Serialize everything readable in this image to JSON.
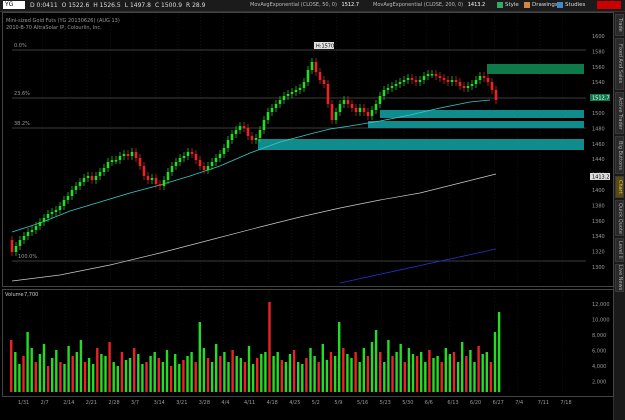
{
  "toolbar": {
    "symbol": "YG",
    "ohlc": {
      "change": "D 0:0411",
      "open": "O 1522.6",
      "high": "H 1526.5",
      "low": "L 1497.8",
      "close": "C 1500.9",
      "range": "R 28.9"
    },
    "ma50_label": "MovAvgExponential (CLOSE, 50, 0)",
    "ma50_value": "1512.7",
    "ma200_label": "MovAvgExponential (CLOSE, 200, 0)",
    "ma200_value": "1413.2",
    "style_label": "Style",
    "drawings_label": "Drawings",
    "studies_label": "Studies"
  },
  "chart": {
    "subtitle": "Mini-sized Gold Futs (YG 20130626) (AUG 13)",
    "subtitle2": "2010-B-70 AltraSolar IP, Colourlin, Inc.",
    "high_marker": "H:1570",
    "fib_labels": {
      "f0": "0.0%",
      "f23": "23.6%",
      "f38": "38.2%",
      "f100": "100.0%"
    },
    "price_tag_current": "1512.7",
    "price_tag_ma200": "1413.2",
    "price_axis": [
      "1600",
      "1580",
      "1560",
      "1540",
      "1520",
      "1500",
      "1480",
      "1460",
      "1440",
      "1420",
      "1400",
      "1380",
      "1360",
      "1340",
      "1320",
      "1300"
    ],
    "date_axis": [
      "1/31",
      "2/7",
      "2/14",
      "2/21",
      "2/28",
      "3/7",
      "3/14",
      "3/21",
      "3/28",
      "4/4",
      "4/11",
      "4/18",
      "4/25",
      "5/2",
      "5/9",
      "5/16",
      "5/23",
      "5/30",
      "6/6",
      "6/13",
      "6/20",
      "6/27",
      "7/4",
      "7/11",
      "7/18"
    ]
  },
  "volume": {
    "title": "Volume",
    "value": "7,700",
    "axis": [
      "12,000",
      "10,000",
      "8,000",
      "6,000",
      "4,000",
      "2,000"
    ]
  },
  "sidebar_tabs": [
    "Trade",
    "Fixed And Sales",
    "Active Trader",
    "Big Buttons",
    "Chart",
    "Quick Quote",
    "Level II",
    "Live News"
  ],
  "colors": {
    "up": "#22dd22",
    "down": "#ee2222",
    "ma50": "#33cccc",
    "ma200": "#cccccc",
    "trend": "#2233cc",
    "zone_teal": "#118c8c",
    "zone_green": "#0e7a4a"
  }
}
